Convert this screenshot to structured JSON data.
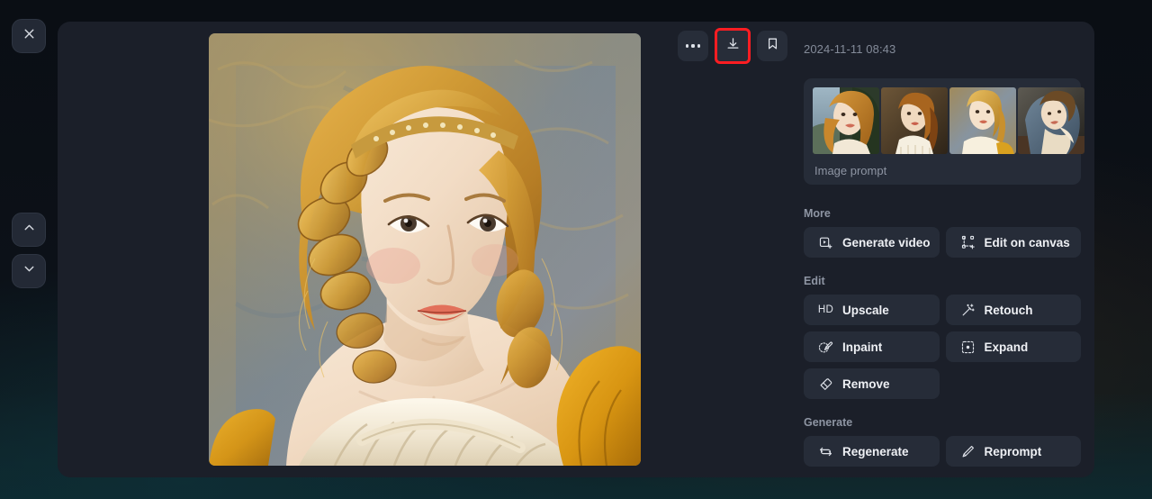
{
  "theme": {
    "page_bg": "#0d1117",
    "modal_bg": "#1b1f29",
    "button_bg": "#262c38",
    "text_primary": "#eef0f4",
    "text_muted": "#8e95a3",
    "highlight_outline": "#ff1d22"
  },
  "left_rail": {
    "close_label": "Close",
    "nav_up_label": "Previous",
    "nav_down_label": "Next"
  },
  "toolbar": {
    "more_label": "More options",
    "download_label": "Download",
    "bookmark_label": "Bookmark"
  },
  "preview": {
    "alt": "Portrait of a young woman with golden braided hair in neoclassical painting style"
  },
  "side_panel": {
    "timestamp": "2024-11-11 08:43",
    "prompt_card": {
      "label": "Image prompt",
      "thumbnails": [
        {
          "name": "thumbnail-1",
          "alt": "Woman with flowing red-gold curls by a landscape"
        },
        {
          "name": "thumbnail-2",
          "alt": "Woman in white chemise with brown shawl"
        },
        {
          "name": "thumbnail-3",
          "alt": "Blonde woman in cream gown on blue-grey ground"
        },
        {
          "name": "thumbnail-4",
          "alt": "Woman in blue dress resting head on hand"
        }
      ]
    },
    "sections": [
      {
        "key": "more",
        "title": "More",
        "buttons": [
          {
            "label": "Generate video",
            "icon": "video-plus-icon"
          },
          {
            "label": "Edit on canvas",
            "icon": "canvas-transform-icon"
          }
        ]
      },
      {
        "key": "edit",
        "title": "Edit",
        "buttons": [
          {
            "label": "Upscale",
            "icon": "hd-icon"
          },
          {
            "label": "Retouch",
            "icon": "magic-wand-icon"
          },
          {
            "label": "Inpaint",
            "icon": "brush-selection-icon"
          },
          {
            "label": "Expand",
            "icon": "expand-dashed-icon"
          },
          {
            "label": "Remove",
            "icon": "eraser-icon"
          }
        ]
      },
      {
        "key": "generate",
        "title": "Generate",
        "buttons": [
          {
            "label": "Regenerate",
            "icon": "refresh-icon"
          },
          {
            "label": "Reprompt",
            "icon": "pencil-icon"
          }
        ]
      }
    ]
  }
}
